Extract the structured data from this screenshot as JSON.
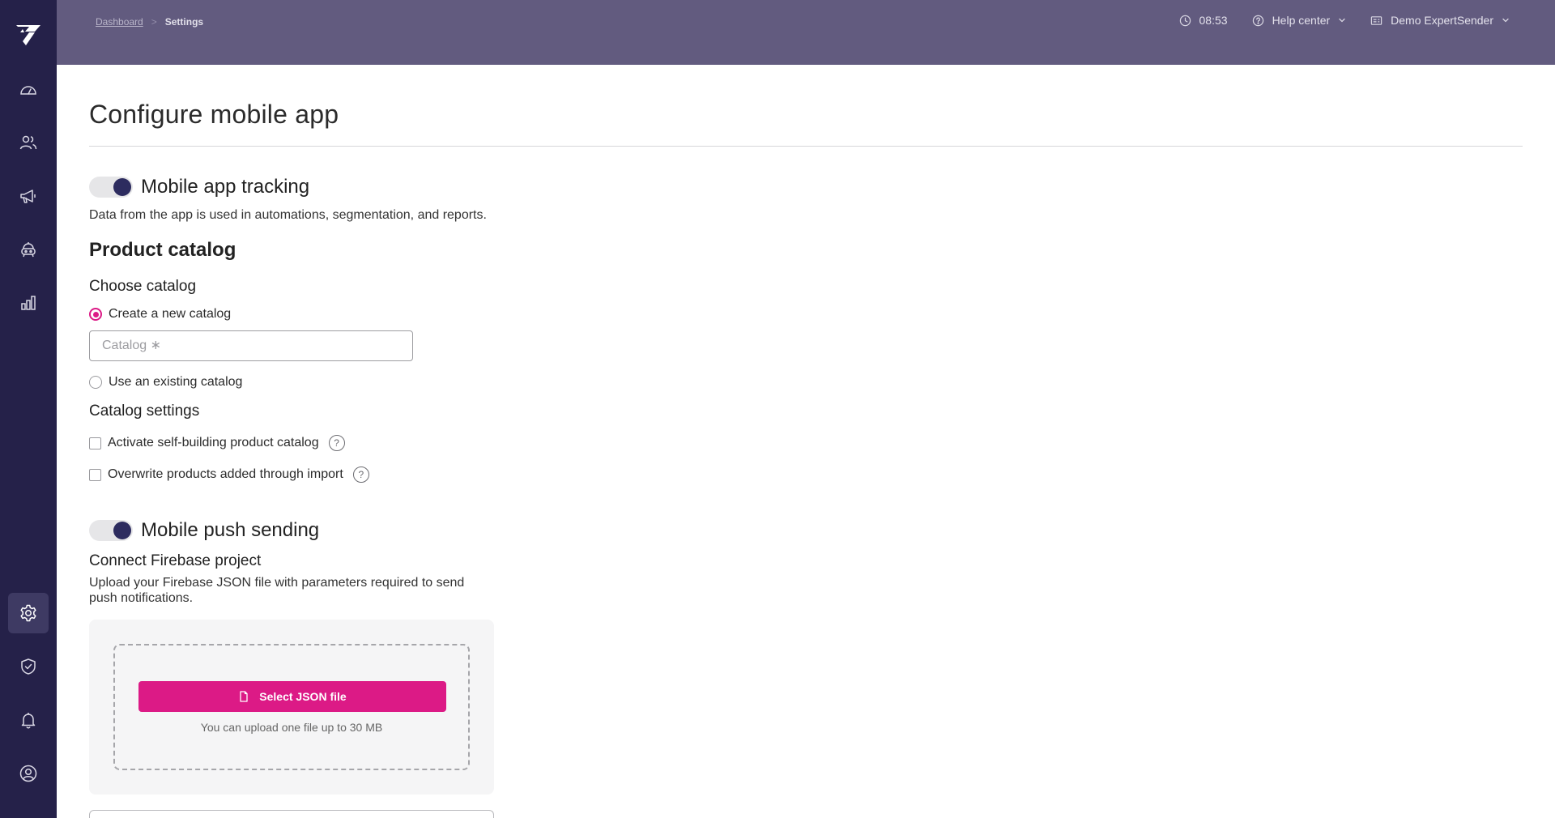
{
  "header": {
    "breadcrumb": {
      "parent": "Dashboard",
      "separator": ">",
      "current": "Settings"
    },
    "clock": "08:53",
    "help_label": "Help center",
    "account_label": "Demo ExpertSender"
  },
  "sidebar": {
    "items": [
      {
        "name": "dashboard",
        "icon": "gauge-icon"
      },
      {
        "name": "contacts",
        "icon": "users-icon"
      },
      {
        "name": "campaigns",
        "icon": "megaphone-icon"
      },
      {
        "name": "automation",
        "icon": "robot-icon"
      },
      {
        "name": "reports",
        "icon": "bar-chart-icon"
      },
      {
        "name": "settings",
        "icon": "gear-icon",
        "active": true
      },
      {
        "name": "security",
        "icon": "shield-check-icon"
      },
      {
        "name": "notifications",
        "icon": "bell-icon"
      },
      {
        "name": "profile",
        "icon": "user-circle-icon"
      }
    ]
  },
  "page": {
    "title": "Configure mobile app",
    "tracking": {
      "label": "Mobile app tracking",
      "enabled": true,
      "description": "Data from the app is used in automations, segmentation, and reports."
    },
    "product_catalog": {
      "title": "Product catalog",
      "choose_title": "Choose catalog",
      "option_new": "Create a new catalog",
      "catalog_placeholder": "Catalog ∗",
      "option_existing": "Use an existing catalog",
      "selected": "new"
    },
    "catalog_settings": {
      "title": "Catalog settings",
      "self_building_label": "Activate self-building product catalog",
      "overwrite_label": "Overwrite products added through import",
      "help_glyph": "?"
    },
    "push": {
      "label": "Mobile push sending",
      "enabled": true,
      "firebase_title": "Connect Firebase project",
      "firebase_description_line1": "Upload your Firebase JSON file with parameters required to send",
      "firebase_description_line2": "push notifications.",
      "select_button": "Select JSON file",
      "upload_hint": "You can upload one file up to 30 MB"
    }
  },
  "colors": {
    "sidebar": "#252149",
    "topbar": "#625b7f",
    "accent": "#dc1a86",
    "toggle_knob": "#2d2c5f"
  }
}
